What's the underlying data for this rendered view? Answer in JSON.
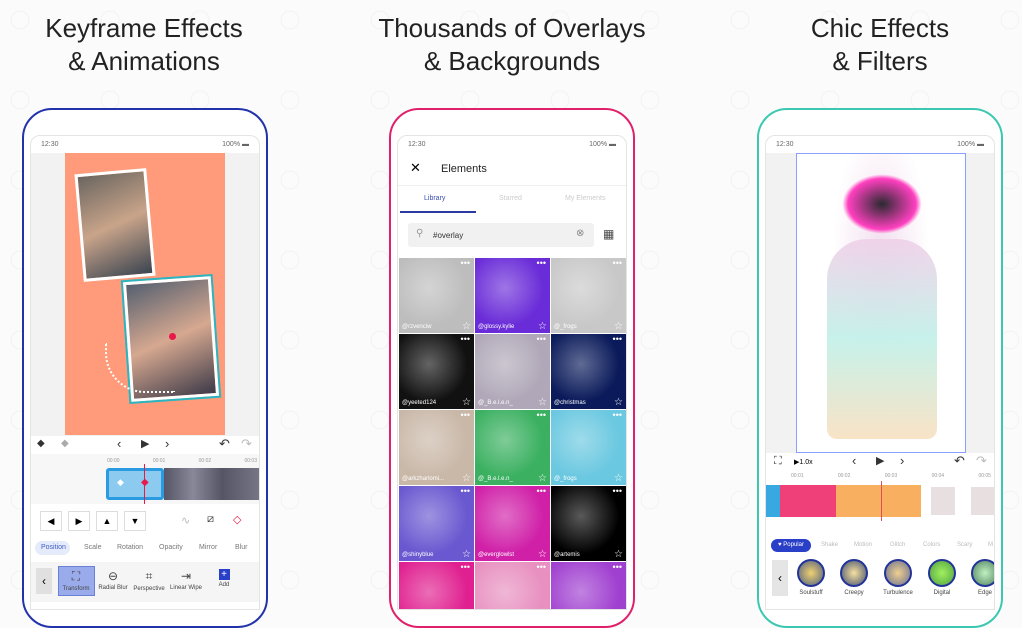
{
  "panels": [
    {
      "title_line1": "Keyframe Effects",
      "title_line2": "& Animations",
      "frame_color": "#2233aa"
    },
    {
      "title_line1": "Thousands of Overlays",
      "title_line2": "& Backgrounds",
      "frame_color": "#e0206a"
    },
    {
      "title_line1": "Chic Effects",
      "title_line2": "& Filters",
      "frame_color": "#3cc8b0"
    }
  ],
  "status": {
    "time": "12:30",
    "battery": "100%"
  },
  "keyframe": {
    "timeline_ticks": [
      "00:00",
      "00:01",
      "00:02",
      "00:03"
    ],
    "tabs": [
      "Position",
      "Scale",
      "Rotation",
      "Opacity",
      "Mirror",
      "Blur"
    ],
    "active_tab": "Position",
    "tools": [
      {
        "label": "Transform",
        "icon": "transform-icon"
      },
      {
        "label": "Radial Blur",
        "icon": "radial-blur-icon"
      },
      {
        "label": "Perspective",
        "icon": "perspective-icon"
      },
      {
        "label": "Linear Wipe",
        "icon": "linear-wipe-icon"
      },
      {
        "label": "Add",
        "icon": "plus-icon"
      }
    ],
    "canvas_color": "#ff9b7a",
    "keyframe_color": "#e8184a"
  },
  "elements": {
    "header": "Elements",
    "tabs": [
      "Library",
      "Starred",
      "My Elements"
    ],
    "active_tab": "Library",
    "search_value": "#overlay",
    "grid": [
      {
        "user": "@rzvenciw",
        "bg": "#bdbdbd"
      },
      {
        "user": "@glossy.kylie",
        "bg": "#6a2cd8"
      },
      {
        "user": "@_frogs",
        "bg": "#c8c8c8"
      },
      {
        "user": "@yeeted124",
        "bg": "#111111"
      },
      {
        "user": "@_B.e.l.e.n_",
        "bg": "#b0a8b8"
      },
      {
        "user": "@christmas",
        "bg": "#0a1a5a"
      },
      {
        "user": "@arkzharlomi...",
        "bg": "#c9b8a8"
      },
      {
        "user": "@_B.e.l.e.n_",
        "bg": "#3ab060"
      },
      {
        "user": "@_frogs",
        "bg": "#6ac8e0"
      },
      {
        "user": "@shinyblue",
        "bg": "#6a58d0"
      },
      {
        "user": "@everglowlst",
        "bg": "#d020a8"
      },
      {
        "user": "@artemis",
        "bg": "#000000"
      },
      {
        "user": "",
        "bg": "#e02090"
      },
      {
        "user": "",
        "bg": "#e890c0"
      },
      {
        "user": "",
        "bg": "#a040d0"
      }
    ]
  },
  "effects": {
    "speed": "1.0x",
    "timeline_ticks": [
      "00:01",
      "00:02",
      "00:03",
      "00:04",
      "00:05"
    ],
    "categories": [
      "Popular",
      "Shake",
      "Motion",
      "Glitch",
      "Colors",
      "Scary",
      "M"
    ],
    "active_category": "Popular",
    "items": [
      "Soulstuff",
      "Creepy",
      "Turbulence",
      "Digital",
      "Edge"
    ],
    "accent": "#2a3fc8"
  }
}
